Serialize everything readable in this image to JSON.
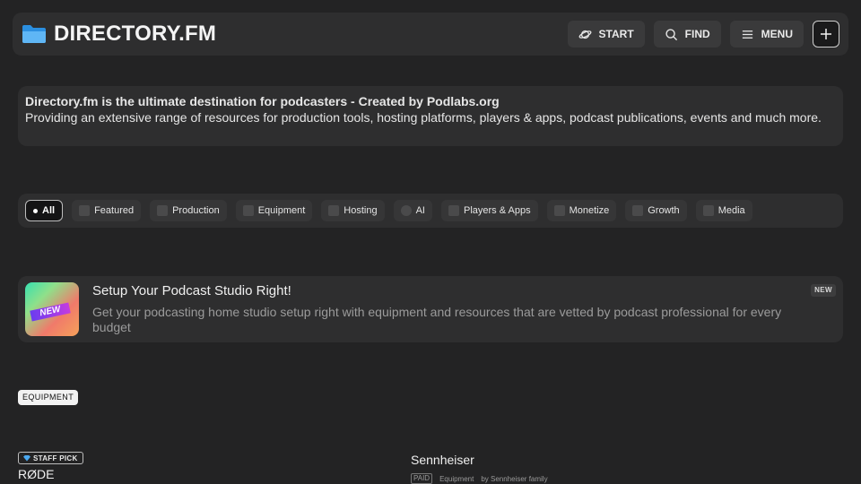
{
  "header": {
    "logo_text": "DIRECTORY.FM",
    "start_label": "START",
    "find_label": "FIND",
    "menu_label": "MENU"
  },
  "intro": {
    "headline": "Directory.fm is the ultimate destination for podcasters - Created by Podlabs.org",
    "body": "Providing an extensive range of resources for production tools, hosting platforms, players & apps, podcast publications, events and much more."
  },
  "filters": [
    {
      "label": "All",
      "active": true
    },
    {
      "label": "Featured"
    },
    {
      "label": "Production"
    },
    {
      "label": "Equipment"
    },
    {
      "label": "Hosting"
    },
    {
      "label": "AI"
    },
    {
      "label": "Players & Apps"
    },
    {
      "label": "Monetize"
    },
    {
      "label": "Growth"
    },
    {
      "label": "Media"
    }
  ],
  "promo": {
    "thumb_text": "NEW",
    "title": "Setup Your Podcast Studio Right!",
    "description": "Get your podcasting home studio setup right with equipment and resources that are vetted by podcast professional for every budget",
    "badge": "NEW"
  },
  "section": {
    "tag": "EQUIPMENT"
  },
  "cards": {
    "left": {
      "staff_pick": "STAFF PICK",
      "title": "RØDE"
    },
    "right": {
      "title": "Sennheiser",
      "paid": "PAID",
      "category": "Equipment",
      "byline": "by Sennheiser family"
    }
  },
  "colors": {
    "background": "#232324",
    "panel": "#2e2e2f",
    "folder_icon": "#4aa8f0"
  }
}
